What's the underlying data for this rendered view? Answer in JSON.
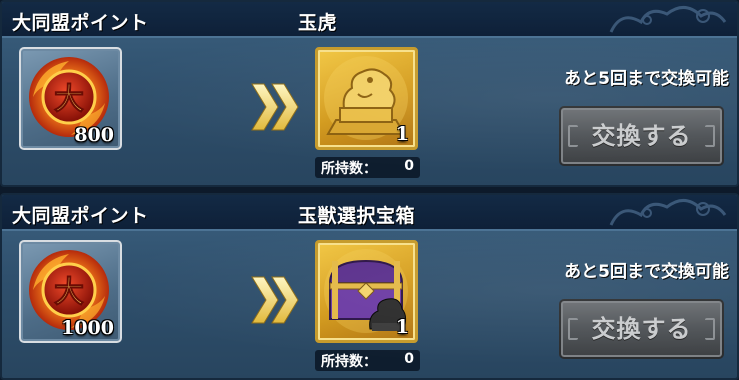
{
  "rows": [
    {
      "currency_label": "大同盟ポイント",
      "cost": "800",
      "reward_name": "玉虎",
      "reward_qty": "1",
      "owned_label": "所持数：",
      "owned_count": "0",
      "remaining_text": "あと5回まで交換可能",
      "button_label": "交換する",
      "reward_icon": "jade-tiger-seal-icon"
    },
    {
      "currency_label": "大同盟ポイント",
      "cost": "1000",
      "reward_name": "玉獣選択宝箱",
      "reward_qty": "1",
      "owned_label": "所持数：",
      "owned_count": "0",
      "remaining_text": "あと5回まで交換可能",
      "button_label": "交換する",
      "reward_icon": "treasure-chest-icon"
    }
  ],
  "colors": {
    "panel": "#2f506d",
    "header": "#0e2038",
    "reward_frame": "#d39a1b",
    "button_disabled": "#4e5256"
  }
}
